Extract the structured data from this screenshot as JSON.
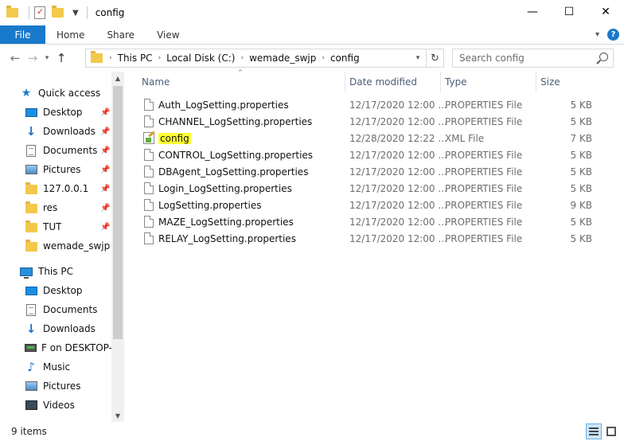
{
  "window": {
    "title": "config",
    "minimize_glyph": "—",
    "maximize_glyph": "☐",
    "close_glyph": "✕"
  },
  "ribbon": {
    "tabs": [
      "File",
      "Home",
      "Share",
      "View"
    ],
    "help_glyph": "?"
  },
  "address": {
    "crumbs": [
      "This PC",
      "Local Disk (C:)",
      "wemade_swjp",
      "config"
    ],
    "search_placeholder": "Search config"
  },
  "nav": {
    "quick_access": "Quick access",
    "quick_items": [
      {
        "label": "Desktop",
        "icon": "desktop-icon"
      },
      {
        "label": "Downloads",
        "icon": "downloads-icon"
      },
      {
        "label": "Documents",
        "icon": "documents-icon"
      },
      {
        "label": "Pictures",
        "icon": "pictures-icon"
      },
      {
        "label": "127.0.0.1",
        "icon": "folder-icon"
      },
      {
        "label": "res",
        "icon": "folder-icon"
      },
      {
        "label": "TUT",
        "icon": "folder-icon"
      },
      {
        "label": "wemade_swjp",
        "icon": "folder-icon"
      }
    ],
    "this_pc": "This PC",
    "pc_items": [
      {
        "label": "Desktop",
        "icon": "desktop-icon"
      },
      {
        "label": "Documents",
        "icon": "documents-icon"
      },
      {
        "label": "Downloads",
        "icon": "downloads-icon"
      },
      {
        "label": "F on DESKTOP-B",
        "icon": "network-drive-icon"
      },
      {
        "label": "Music",
        "icon": "music-icon"
      },
      {
        "label": "Pictures",
        "icon": "pictures-icon"
      },
      {
        "label": "Videos",
        "icon": "videos-icon"
      }
    ]
  },
  "columns": {
    "name": "Name",
    "date": "Date modified",
    "type": "Type",
    "size": "Size"
  },
  "files": [
    {
      "name": "Auth_LogSetting.properties",
      "date": "12/17/2020 12:00 ...",
      "type": "PROPERTIES File",
      "size": "5 KB",
      "kind": "file"
    },
    {
      "name": "CHANNEL_LogSetting.properties",
      "date": "12/17/2020 12:00 ...",
      "type": "PROPERTIES File",
      "size": "5 KB",
      "kind": "file"
    },
    {
      "name": "config",
      "date": "12/28/2020 12:22 ...",
      "type": "XML File",
      "size": "7 KB",
      "kind": "xml"
    },
    {
      "name": "CONTROL_LogSetting.properties",
      "date": "12/17/2020 12:00 ...",
      "type": "PROPERTIES File",
      "size": "5 KB",
      "kind": "file"
    },
    {
      "name": "DBAgent_LogSetting.properties",
      "date": "12/17/2020 12:00 ...",
      "type": "PROPERTIES File",
      "size": "5 KB",
      "kind": "file"
    },
    {
      "name": "Login_LogSetting.properties",
      "date": "12/17/2020 12:00 ...",
      "type": "PROPERTIES File",
      "size": "5 KB",
      "kind": "file"
    },
    {
      "name": "LogSetting.properties",
      "date": "12/17/2020 12:00 ...",
      "type": "PROPERTIES File",
      "size": "9 KB",
      "kind": "file"
    },
    {
      "name": "MAZE_LogSetting.properties",
      "date": "12/17/2020 12:00 ...",
      "type": "PROPERTIES File",
      "size": "5 KB",
      "kind": "file"
    },
    {
      "name": "RELAY_LogSetting.properties",
      "date": "12/17/2020 12:00 ...",
      "type": "PROPERTIES File",
      "size": "5 KB",
      "kind": "file"
    }
  ],
  "status": {
    "items_count": "9 items"
  },
  "colors": {
    "accent": "#1979ca",
    "highlight": "#ffff33"
  }
}
